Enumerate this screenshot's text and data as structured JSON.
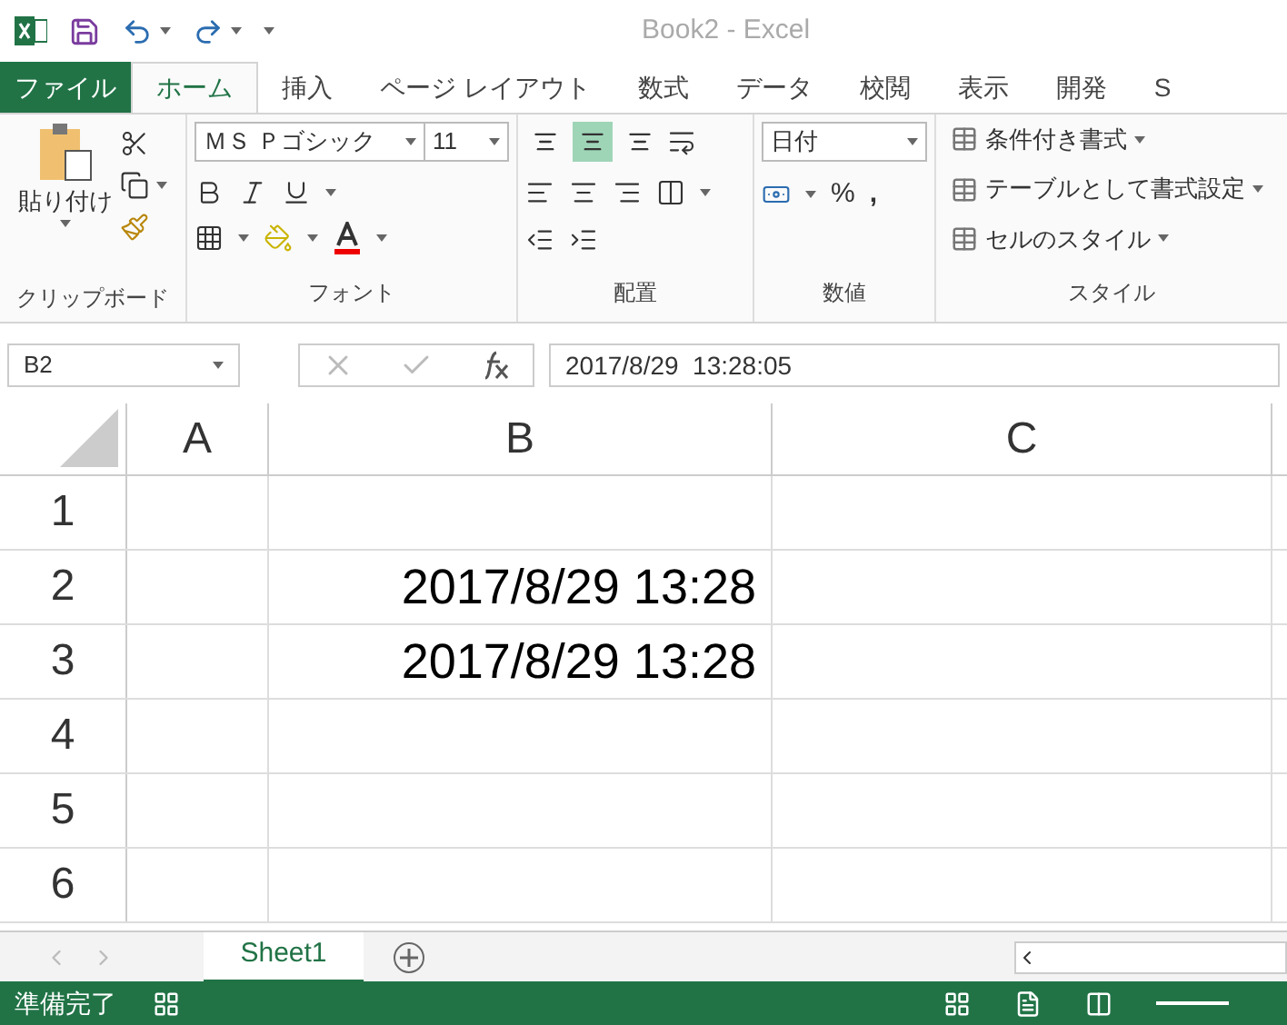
{
  "window": {
    "title": "Book2 - Excel"
  },
  "tabs": [
    {
      "label": "ファイル",
      "kind": "file",
      "selected": false
    },
    {
      "label": "ホーム",
      "kind": "tab",
      "selected": true
    },
    {
      "label": "挿入",
      "kind": "tab",
      "selected": false
    },
    {
      "label": "ページ レイアウト",
      "kind": "tab",
      "selected": false
    },
    {
      "label": "数式",
      "kind": "tab",
      "selected": false
    },
    {
      "label": "データ",
      "kind": "tab",
      "selected": false
    },
    {
      "label": "校閲",
      "kind": "tab",
      "selected": false
    },
    {
      "label": "表示",
      "kind": "tab",
      "selected": false
    },
    {
      "label": "開発",
      "kind": "tab",
      "selected": false
    },
    {
      "label": "S",
      "kind": "tab",
      "selected": false
    }
  ],
  "ribbon": {
    "clipboard": {
      "paste": "貼り付け",
      "label": "クリップボード"
    },
    "font": {
      "name": "ＭＳ Ｐゴシック",
      "size": "11",
      "label": "フォント"
    },
    "alignment": {
      "vertical": [
        {
          "selected": false
        },
        {
          "selected": true
        },
        {
          "selected": false
        }
      ],
      "label": "配置"
    },
    "number": {
      "format": "日付",
      "percent": "%",
      "comma": ",",
      "label": "数値"
    },
    "styles": {
      "items": [
        "条件付き書式",
        "テーブルとして書式設定",
        "セルのスタイル"
      ],
      "label": "スタイル"
    }
  },
  "formula_bar": {
    "name_box": "B2",
    "value": "2017/8/29  13:28:05"
  },
  "sheet": {
    "columns": [
      "A",
      "B",
      "C"
    ],
    "rows": [
      {
        "header": "1",
        "cells": [
          "",
          "",
          ""
        ]
      },
      {
        "header": "2",
        "cells": [
          "",
          "2017/8/29 13:28",
          ""
        ]
      },
      {
        "header": "3",
        "cells": [
          "",
          "2017/8/29 13:28",
          ""
        ]
      },
      {
        "header": "4",
        "cells": [
          "",
          "",
          ""
        ]
      },
      {
        "header": "5",
        "cells": [
          "",
          "",
          ""
        ]
      },
      {
        "header": "6",
        "cells": [
          "",
          "",
          ""
        ]
      }
    ]
  },
  "sheet_tabs": [
    {
      "label": "Sheet1",
      "selected": true
    }
  ],
  "status_bar": {
    "text": "準備完了"
  }
}
